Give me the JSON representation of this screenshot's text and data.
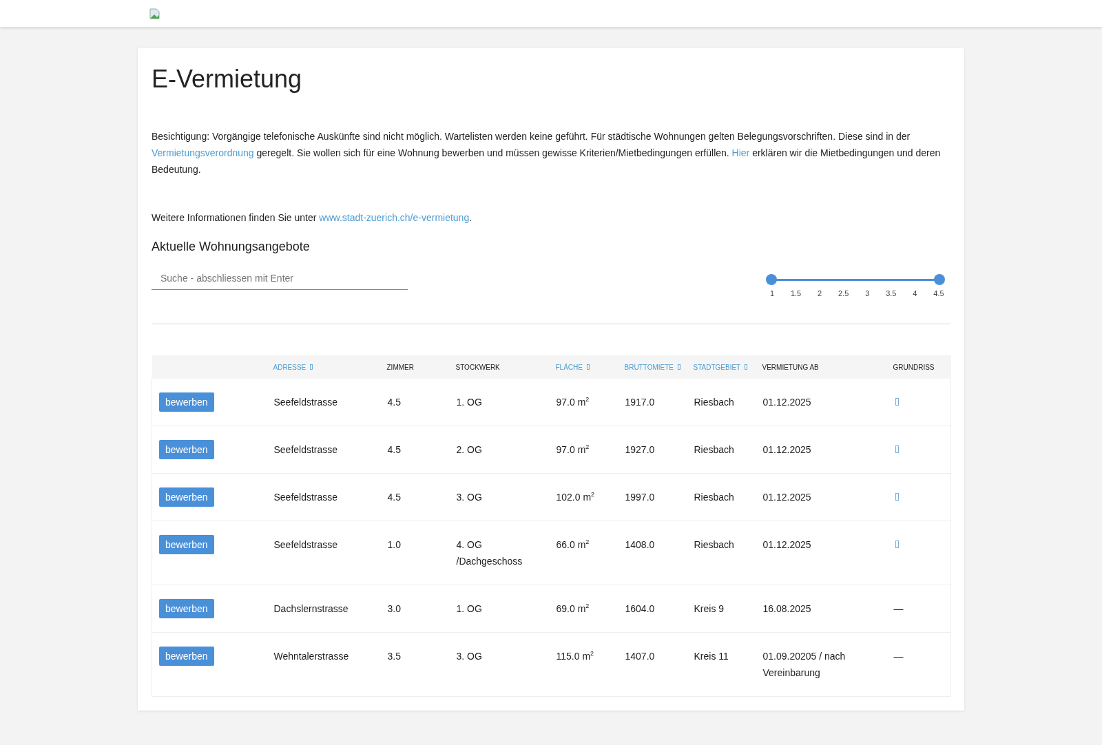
{
  "page": {
    "title": "E-Vermietung",
    "intro": "Besichtigung: Vorgängige telefonische Auskünfte sind nicht möglich. Wartelisten werden keine geführt. Für städtische Wohnungen gelten Belegungsvorschriften. Diese sind in der ",
    "intro_link_1": "Vermietungsverordnung",
    "intro_mid": " geregelt. Sie wollen sich für eine Wohnung bewerben und müssen gewisse Kriterien/Mietbedingungen erfüllen. ",
    "intro_link_2": "Hier",
    "intro_end": " erklären wir die Mietbedingungen und deren Bedeutung.",
    "info": "Weitere Informationen finden Sie unter ",
    "info_link": "www.stadt-zuerich.ch/e-vermietung",
    "info_end": ".",
    "section_title": "Aktuelle Wohnungsangebote"
  },
  "search": {
    "placeholder": "Suche - abschliessen mit Enter"
  },
  "slider": {
    "thumbs": [
      {
        "level": 0
      },
      {
        "level": 1
      }
    ],
    "ticks": [
      "1",
      "1.5",
      "2",
      "2.5",
      "3",
      "3.5",
      "4",
      "4.5"
    ]
  },
  "table": {
    "columns": [
      {
        "label": "ADRESSE",
        "sortable": true
      },
      {
        "label": "ZIMMER",
        "sortable": false
      },
      {
        "label": "STOCKWERK",
        "sortable": false
      },
      {
        "label": "FLÄCHE",
        "sortable": true
      },
      {
        "label": "BRUTTOMIETE",
        "sortable": true
      },
      {
        "label": "STADTGEBIET",
        "sortable": true
      },
      {
        "label": "VERMIETUNG AB",
        "sortable": false
      },
      {
        "label": "GRUNDRISS",
        "sortable": false
      }
    ],
    "rows": [
      {
        "action": "bewerben",
        "address": "Seefeldstrasse",
        "rooms": "4.5",
        "floor": "1. OG",
        "area": "97.0 m$^{2}$",
        "rent": "1917.0",
        "district": "Riesbach",
        "available": "01.12.2025",
        "plan": {
          "kind": "icon"
        }
      },
      {
        "action": "bewerben",
        "address": "Seefeldstrasse",
        "rooms": "4.5",
        "floor": "2. OG",
        "area": "97.0 m$^{2}$",
        "rent": "1927.0",
        "district": "Riesbach",
        "available": "01.12.2025",
        "plan": {
          "kind": "icon"
        }
      },
      {
        "action": "bewerben",
        "address": "Seefeldstrasse",
        "rooms": "4.5",
        "floor": "3. OG",
        "area": "102.0 m$^{2}$",
        "rent": "1997.0",
        "district": "Riesbach",
        "available": "01.12.2025",
        "plan": {
          "kind": "icon"
        }
      },
      {
        "action": "bewerben",
        "address": "Seefeldstrasse",
        "rooms": "1.0",
        "floor": "4. OG /Dachgeschoss",
        "area": "66.0 m$^{2}$",
        "rent": "1408.0",
        "district": "Riesbach",
        "available": "01.12.2025",
        "plan": {
          "kind": "icon"
        }
      },
      {
        "action": "bewerben",
        "address": "Dachslernstrasse",
        "rooms": "3.0",
        "floor": "1. OG",
        "area": "69.0 m$^{2}$",
        "rent": "1604.0",
        "district": "Kreis 9",
        "available": "16.08.2025",
        "plan": {
          "kind": "text",
          "text": "—"
        }
      },
      {
        "action": "bewerben",
        "address": "Wehntalerstrasse",
        "rooms": "3.5",
        "floor": "3. OG",
        "area": "115.0 m$^{2}$",
        "rent": "1407.0",
        "district": "Kreis 11",
        "available": "01.09.20205 / nach Vereinbarung",
        "plan": {
          "kind": "text",
          "text": "—"
        }
      }
    ]
  }
}
